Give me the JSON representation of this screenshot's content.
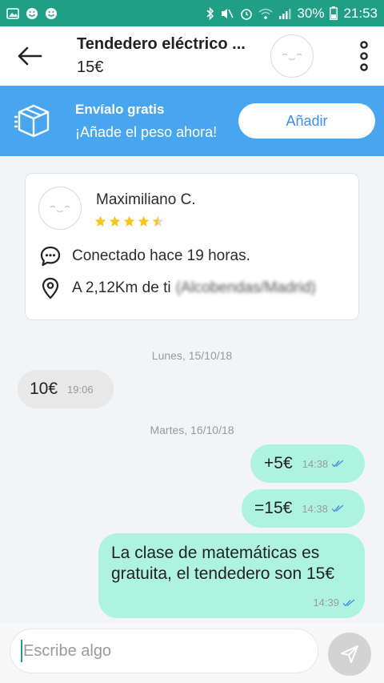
{
  "status_bar": {
    "battery": "30%",
    "time": "21:53"
  },
  "header": {
    "title": "Tendedero eléctrico ...",
    "price": "15€"
  },
  "promo": {
    "title": "Envíalo gratis",
    "subtitle": "¡Añade el peso ahora!",
    "button_label": "Añadir",
    "color": "#48a6f1"
  },
  "seller": {
    "name": "Maximiliano C.",
    "rating": 4.5,
    "rating_max": 5,
    "last_seen": "Conectado hace 19 horas.",
    "distance": "A 2,12Km de ti",
    "location_blurred": "(Alcobendas/Madrid)"
  },
  "chat": {
    "days": [
      "Lunes, 15/10/18",
      "Martes, 16/10/18"
    ],
    "messages": [
      {
        "text": "10€",
        "time": "19:06",
        "from": "other"
      },
      {
        "text": "+5€",
        "time": "14:38",
        "from": "me"
      },
      {
        "text": "=15€",
        "time": "14:38",
        "from": "me"
      },
      {
        "text": "La clase de matemáticas es gratuita, el tendedero son 15€",
        "time": "14:39",
        "from": "me"
      }
    ]
  },
  "composer": {
    "placeholder": "Escribe algo"
  },
  "colors": {
    "status_bar": "#1f9f86",
    "outgoing_bubble": "#aef3e0",
    "incoming_bubble": "#e8e8e8",
    "star": "#f5c518",
    "tick": "#4a90e2"
  }
}
